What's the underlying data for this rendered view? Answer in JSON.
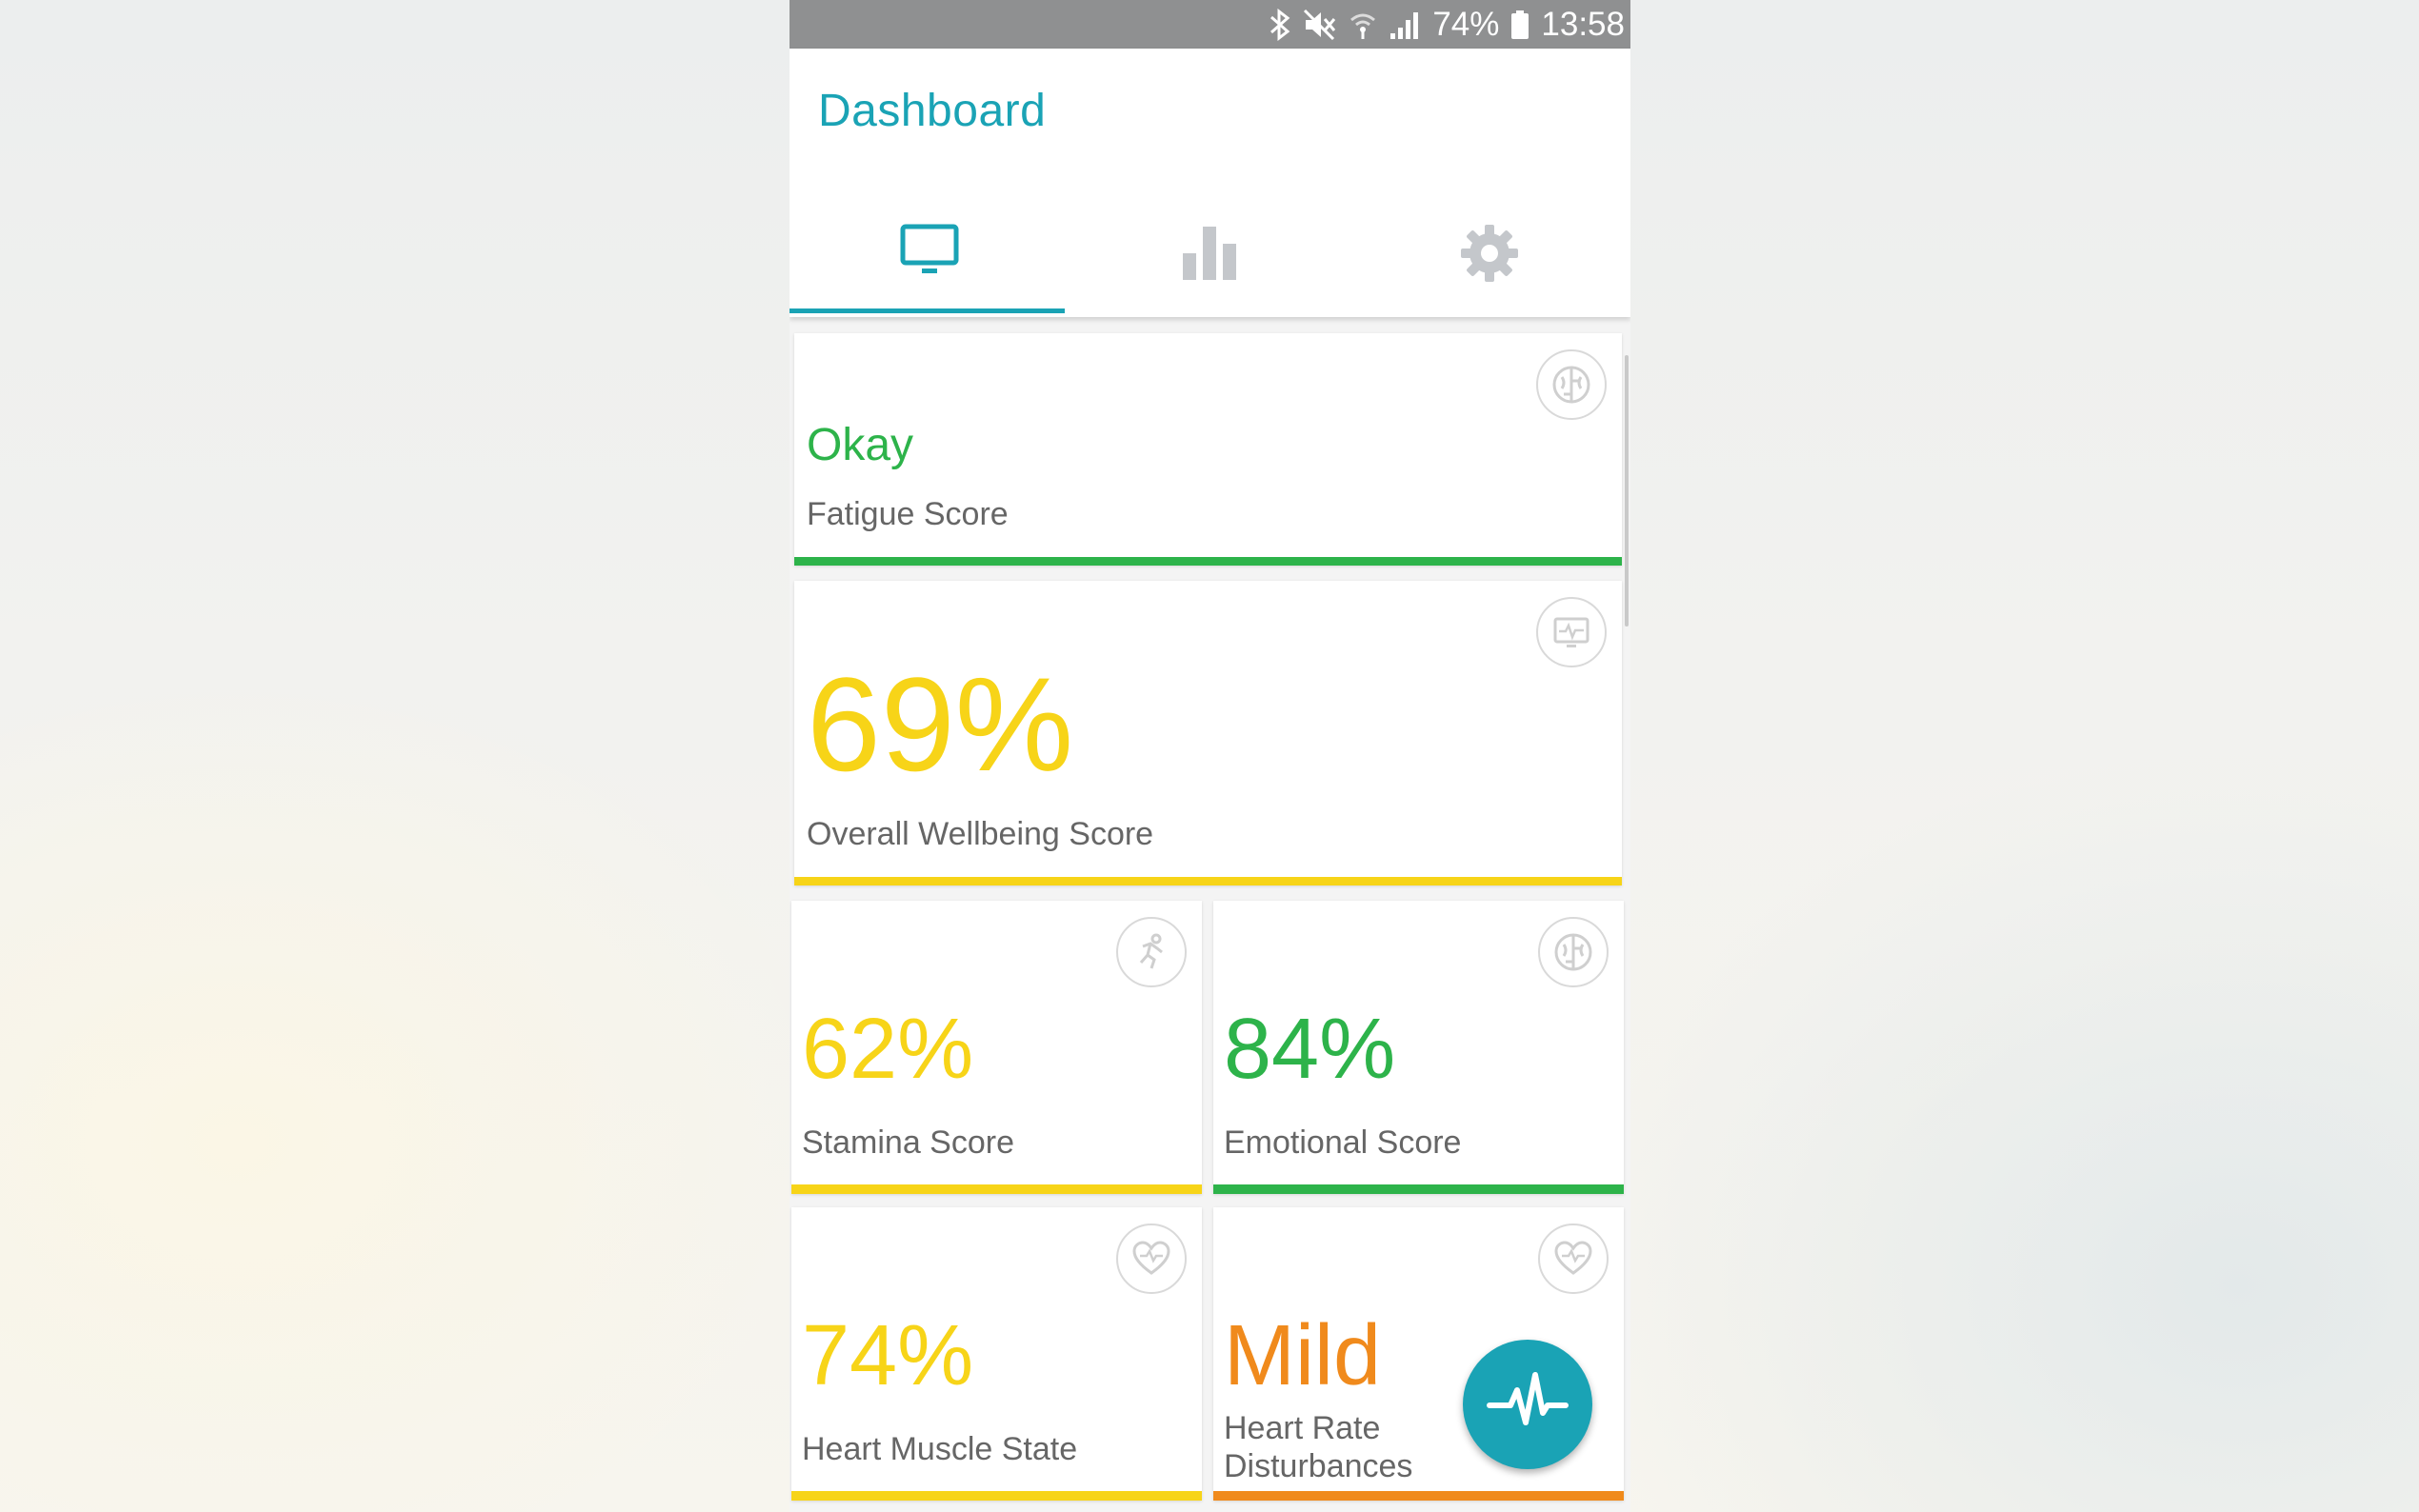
{
  "status_bar": {
    "battery": "74%",
    "time": "13:58"
  },
  "app_bar": {
    "title": "Dashboard"
  },
  "tabs": [
    {
      "name": "dashboard",
      "icon": "monitor-icon",
      "active": true
    },
    {
      "name": "statistics",
      "icon": "bar-chart-icon",
      "active": false
    },
    {
      "name": "settings",
      "icon": "gear-icon",
      "active": false
    }
  ],
  "cards": {
    "fatigue": {
      "value": "Okay",
      "label": "Fatigue Score",
      "icon": "brain-icon",
      "color": "#2db34a"
    },
    "wellbeing": {
      "value": "69%",
      "label": "Overall Wellbeing Score",
      "icon": "monitor-pulse-icon",
      "color": "#f7d418"
    },
    "stamina": {
      "value": "62%",
      "label": "Stamina Score",
      "icon": "runner-icon",
      "color": "#f7d418"
    },
    "emotional": {
      "value": "84%",
      "label": "Emotional Score",
      "icon": "brain-icon",
      "color": "#2db34a"
    },
    "heart_muscle": {
      "value": "74%",
      "label": "Heart Muscle State",
      "icon": "heart-icon",
      "color": "#f7d418"
    },
    "heart_rate": {
      "value": "Mild",
      "label_line1": "Heart Rate",
      "label_line2": "Disturbances",
      "icon": "heart-pulse-icon",
      "color": "#f08a1c"
    }
  },
  "fab": {
    "icon": "pulse-icon"
  },
  "colors": {
    "accent": "#1aa3b5",
    "good": "#2db34a",
    "medium": "#f7d418",
    "warning": "#f08a1c"
  }
}
